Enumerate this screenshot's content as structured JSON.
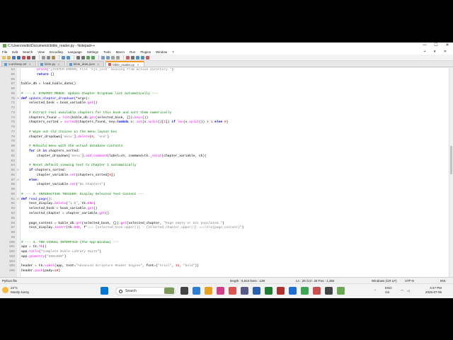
{
  "window": {
    "title": "C:\\Users\\redis\\Documents\\bible_reader.py - Notepad++",
    "controls": [
      "—",
      "☐",
      "✕"
    ]
  },
  "menubar": {
    "items": [
      "File",
      "Edit",
      "Search",
      "View",
      "Encoding",
      "Language",
      "Settings",
      "Tools",
      "Macro",
      "Run",
      "Plugins",
      "Window",
      "?"
    ],
    "right": "+ ▾ ✕"
  },
  "tabs": [
    {
      "label": "cuesheep.txt",
      "active": false
    },
    {
      "label": "bible.py",
      "active": false
    },
    {
      "label": "bible_data.json",
      "active": false
    },
    {
      "label": "bible_reader.py",
      "active": true
    }
  ],
  "editor": {
    "lines": [
      {
        "n": "64",
        "f": "",
        "html": "        <span class='fn'>print</span>(<span class='st'>\"[SYSTEM ERROR] File 'kjv.json' missing from active directory.\"</span>)"
      },
      {
        "n": "65",
        "f": "",
        "html": "        <span class='kw'>return</span> {}"
      },
      {
        "n": "66",
        "f": "",
        "html": ""
      },
      {
        "n": "67",
        "f": "",
        "html": "bible_db = load_bible_data()"
      },
      {
        "n": "68",
        "f": "",
        "html": ""
      },
      {
        "n": "69",
        "f": "",
        "html": "<span class='cm'># --- 2. DYNAMIC MENUS: Update Chapter Dropdown list automatically ---</span>"
      },
      {
        "n": "70",
        "f": "⊟",
        "html": "<span class='kw'>def</span> <span class='def-name'>update_chapter_dropdown</span>(*args):"
      },
      {
        "n": "71",
        "f": "",
        "html": "    selected_book = book_variable.<span class='fn'>get</span>()"
      },
      {
        "n": "72",
        "f": "",
        "html": ""
      },
      {
        "n": "73",
        "f": "",
        "html": "    <span class='cm'># Extract real available chapters for this book and sort them numerically</span>"
      },
      {
        "n": "74",
        "f": "",
        "html": "    chapters_found = <span class='fn'>list</span>(bible_db.<span class='fn'>get</span>(selected_book, {}).<span class='fn'>keys</span>())"
      },
      {
        "n": "75",
        "f": "",
        "html": "    chapters_sorted = <span class='fn'>sorted</span>(chapters_found, key=<span class='kw'>lambda</span> x: <span class='fn'>int</span>(x.<span class='fn'>split</span>()[<span class='nm'>1</span>]) <span class='kw'>if</span> <span class='fn'>len</span>(x.<span class='fn'>split</span>()) > <span class='nm'>1</span> <span class='kw'>else</span> <span class='nm'>0</span>)"
      },
      {
        "n": "76",
        "f": "",
        "html": ""
      },
      {
        "n": "77",
        "f": "",
        "html": "    <span class='cm'># Wipe out old choices in the menu layout box</span>"
      },
      {
        "n": "78",
        "f": "",
        "html": "    chapter_dropdown[<span class='st'>'menu'</span>].<span class='fn'>delete</span>(<span class='nm'>0</span>, <span class='st'>'end'</span>)"
      },
      {
        "n": "79",
        "f": "",
        "html": ""
      },
      {
        "n": "80",
        "f": "",
        "html": "    <span class='cm'># Rebuild menu with the actual database contents</span>"
      },
      {
        "n": "81",
        "f": "",
        "html": "    <span class='kw'>for</span> ch <span class='kw'>in</span> chapters_sorted:"
      },
      {
        "n": "82",
        "f": "",
        "html": "        chapter_dropdown[<span class='st'>'menu'</span>].<span class='fn'>add_command</span>(label=ch, command=tk._<span class='fn'>setit</span>(chapter_variable, ch))"
      },
      {
        "n": "83",
        "f": "",
        "html": ""
      },
      {
        "n": "84",
        "f": "",
        "html": "    <span class='cm'># Reset default viewing text to Chapter 1 automatically</span>"
      },
      {
        "n": "85",
        "f": "⊟",
        "html": "    <span class='kw'>if</span> chapters_sorted:"
      },
      {
        "n": "86",
        "f": "",
        "html": "        chapter_variable.<span class='fn'>set</span>(chapters_sorted[<span class='nm'>0</span>])"
      },
      {
        "n": "87",
        "f": "⊟",
        "html": "    <span class='kw'>else</span>:"
      },
      {
        "n": "88",
        "f": "",
        "html": "        chapter_variable.<span class='fn'>set</span>(<span class='st'>\"No Chapters\"</span>)"
      },
      {
        "n": "89",
        "f": "",
        "html": ""
      },
      {
        "n": "90",
        "f": "",
        "html": "<span class='cm'># --- 3. INTERACTIVE TRIGGER: Display Selected Text Content ---</span>"
      },
      {
        "n": "91",
        "f": "⊟",
        "html": "<span class='kw'>def</span> <span class='def-name'>read_page</span>():"
      },
      {
        "n": "92",
        "f": "",
        "html": "    text_display.<span class='fn'>delete</span>(<span class='st'>\"1.0\"</span>, tk.<span class='fn'>END</span>)"
      },
      {
        "n": "93",
        "f": "",
        "html": "    selected_book = book_variable.<span class='fn'>get</span>()"
      },
      {
        "n": "94",
        "f": "",
        "html": "    selected_chapter = chapter_variable.<span class='fn'>get</span>()"
      },
      {
        "n": "95",
        "f": "",
        "html": ""
      },
      {
        "n": "96",
        "f": "",
        "html": "    page_content = bible_db.<span class='fn'>get</span>(selected_book, {}).<span class='fn'>get</span>(selected_chapter, <span class='st'>\"Page empty or not populated.\"</span>)"
      },
      {
        "n": "97",
        "f": "",
        "html": "    text_display.<span class='fn'>insert</span>(tk.<span class='fn'>END</span>, f<span class='st'>\"=== {selected_book.upper()} - {selected_chapter.upper()} ===\\n\\n{page_content}\"</span>)"
      },
      {
        "n": "98",
        "f": "",
        "html": ""
      },
      {
        "n": "99",
        "f": "",
        "html": ""
      },
      {
        "n": "100",
        "f": "",
        "html": "<span class='cm'># --- 4. THE VISUAL INTERFACE (The App Window) ---</span>"
      },
      {
        "n": "101",
        "f": "",
        "html": "app = tk.<span class='fn'>Tk</span>()"
      },
      {
        "n": "102",
        "f": "",
        "html": "app.<span class='fn'>title</span>(<span class='st'>\"Complete Bible Library Suite\"</span>)"
      },
      {
        "n": "103",
        "f": "",
        "html": "app.<span class='fn'>geometry</span>(<span class='st'>\"650x550\"</span>)"
      },
      {
        "n": "104",
        "f": "",
        "html": ""
      },
      {
        "n": "105",
        "f": "",
        "html": "header = tk.<span class='fn'>Label</span>(app, text=<span class='st'>\"Advanced Scripture Reader Engine\"</span>, font=(<span class='st'>\"Arial\"</span>, <span class='nm'>12</span>, <span class='st'>\"bold\"</span>))"
      },
      {
        "n": "106",
        "f": "",
        "html": "header.<span class='fn'>pack</span>(pady=<span class='nm'>10</span>)"
      }
    ]
  },
  "statusbar": {
    "filetype": "Python file",
    "length": "length : 5,644    lines : 139",
    "position": "Ln : 26    Col : 28    Pos : 1,394",
    "eol": "Windows (CR LF)",
    "encoding": "UTF-8",
    "mode": "INS"
  },
  "taskbar": {
    "weather_temp": "22°C",
    "weather_desc": "Mostly sunny",
    "search_placeholder": "Search",
    "lang": "ENG",
    "region": "US",
    "time": "3:47 PM",
    "date": "2026-07-06"
  }
}
